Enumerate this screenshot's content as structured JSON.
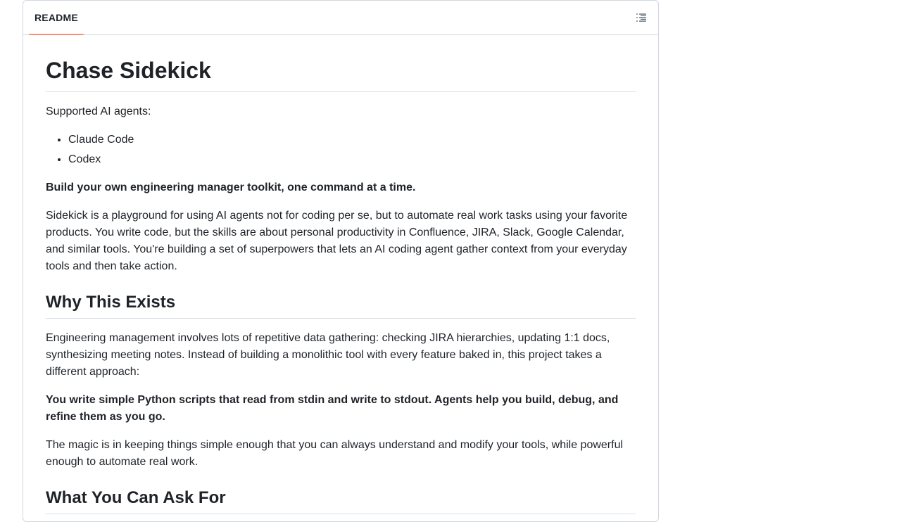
{
  "header": {
    "tab_label": "README",
    "outline_icon": "list-unordered-icon"
  },
  "content": {
    "title": "Chase Sidekick",
    "supported_intro": "Supported AI agents:",
    "agents": [
      "Claude Code",
      "Codex"
    ],
    "tagline": "Build your own engineering manager toolkit, one command at a time.",
    "intro_paragraph": "Sidekick is a playground for using AI agents not for coding per se, but to automate real work tasks using your favorite products. You write code, but the skills are about personal productivity in Confluence, JIRA, Slack, Google Calendar, and similar tools. You're building a set of superpowers that lets an AI coding agent gather context from your everyday tools and then take action.",
    "why_heading": "Why This Exists",
    "why_paragraph": "Engineering management involves lots of repetitive data gathering: checking JIRA hierarchies, updating 1:1 docs, synthesizing meeting notes. Instead of building a monolithic tool with every feature baked in, this project takes a different approach:",
    "why_bold": "You write simple Python scripts that read from stdin and write to stdout. Agents help you build, debug, and refine them as you go.",
    "magic_paragraph": "The magic is in keeping things simple enough that you can always understand and modify your tools, while powerful enough to automate real work.",
    "ask_heading": "What You Can Ask For"
  },
  "colors": {
    "tab_underline": "#fd8c73",
    "border": "#d0d7de",
    "text": "#1f2328"
  }
}
